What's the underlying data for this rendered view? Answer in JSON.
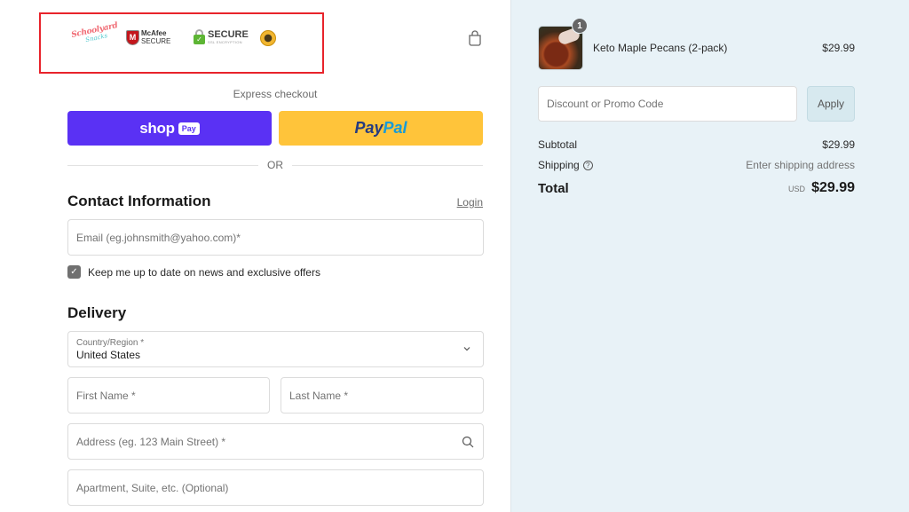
{
  "header": {
    "trust_badges": [
      {
        "name": "Schoolyard Snacks",
        "line1": "Schoolyard",
        "line2": "Snacks"
      },
      {
        "name": "McAfee Secure",
        "line1": "McAfee",
        "line2": "SECURE",
        "glyph": "M"
      },
      {
        "name": "Secure SSL Encryption",
        "line1": "SECURE",
        "line2": "SSL ENCRYPTION",
        "glyph": "✓"
      },
      {
        "name": "Seal badge"
      }
    ],
    "highlight_color": "#e8232b",
    "cart_icon": "shopping-bag-icon"
  },
  "express": {
    "label": "Express checkout",
    "shoppay": {
      "word": "shop",
      "pay": "Pay",
      "color": "#5a31f4"
    },
    "paypal": {
      "part1": "Pay",
      "part2": "Pal",
      "color": "#ffc43a"
    },
    "divider_text": "OR"
  },
  "contact": {
    "title": "Contact Information",
    "login_label": "Login",
    "email_placeholder": "Email (eg.johnsmith@yahoo.com)*",
    "newsletter_label": "Keep me up to date on news and exclusive offers",
    "newsletter_checked": true,
    "check_glyph": "✓"
  },
  "delivery": {
    "title": "Delivery",
    "country_label": "Country/Region *",
    "country_value": "United States",
    "first_name_placeholder": "First Name *",
    "last_name_placeholder": "Last Name *",
    "address_placeholder": "Address (eg. 123 Main Street) *",
    "apartment_placeholder": "Apartment, Suite, etc. (Optional)"
  },
  "summary": {
    "item": {
      "name": "Keto Maple Pecans (2-pack)",
      "price": "$29.99",
      "quantity": "1"
    },
    "promo_placeholder": "Discount or Promo Code",
    "apply_label": "Apply",
    "subtotal_label": "Subtotal",
    "subtotal_value": "$29.99",
    "shipping_label": "Shipping",
    "shipping_help_glyph": "?",
    "shipping_value": "Enter shipping address",
    "total_label": "Total",
    "currency": "USD",
    "total_value": "$29.99",
    "background": "#e8f2f7"
  }
}
